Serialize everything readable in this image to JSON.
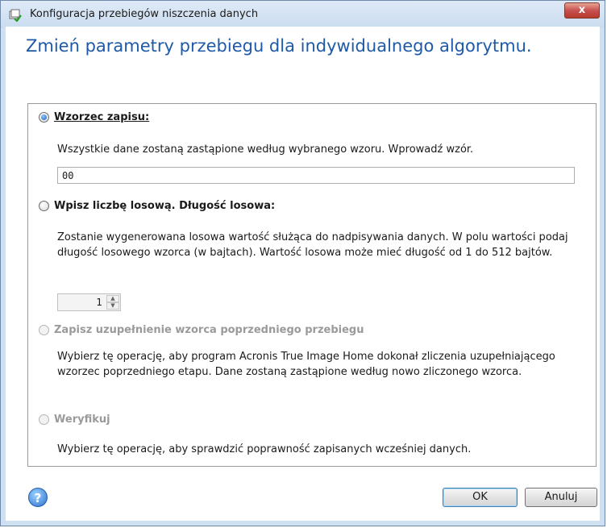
{
  "window": {
    "title": "Konfiguracja przebiegów niszczenia danych",
    "close_label": "x"
  },
  "heading": "Zmień parametry przebiegu dla indywidualnego algorytmu.",
  "options": [
    {
      "label": "Wzorzec zapisu:",
      "checked": true,
      "enabled": true,
      "description": "Wszystkie dane zostaną zastąpione według wybranego wzoru. Wprowadź wzór.",
      "input_value": "00"
    },
    {
      "label": "Wpisz liczbę losową. Długość losowa:",
      "checked": false,
      "enabled": true,
      "description": "Zostanie wygenerowana losowa wartość służąca do nadpisywania danych. W polu wartości podaj długość losowego wzorca (w bajtach). Wartość losowa może mieć długość od 1 do 512 bajtów.",
      "spinner_value": "1"
    },
    {
      "label": "Zapisz uzupełnienie wzorca poprzedniego przebiegu",
      "checked": false,
      "enabled": false,
      "description": "Wybierz tę operację, aby program Acronis True Image Home dokonał zliczenia uzupełniającego wzorzec poprzedniego etapu. Dane zostaną zastąpione według nowo zliczonego wzorca."
    },
    {
      "label": "Weryfikuj",
      "checked": false,
      "enabled": false,
      "description": "Wybierz tę operację, aby sprawdzić poprawność zapisanych wcześniej danych."
    }
  ],
  "buttons": {
    "help": "?",
    "ok": "OK",
    "cancel": "Anuluj"
  },
  "colors": {
    "heading": "#1e5aa8",
    "disabled_text": "#9a9a9a"
  }
}
